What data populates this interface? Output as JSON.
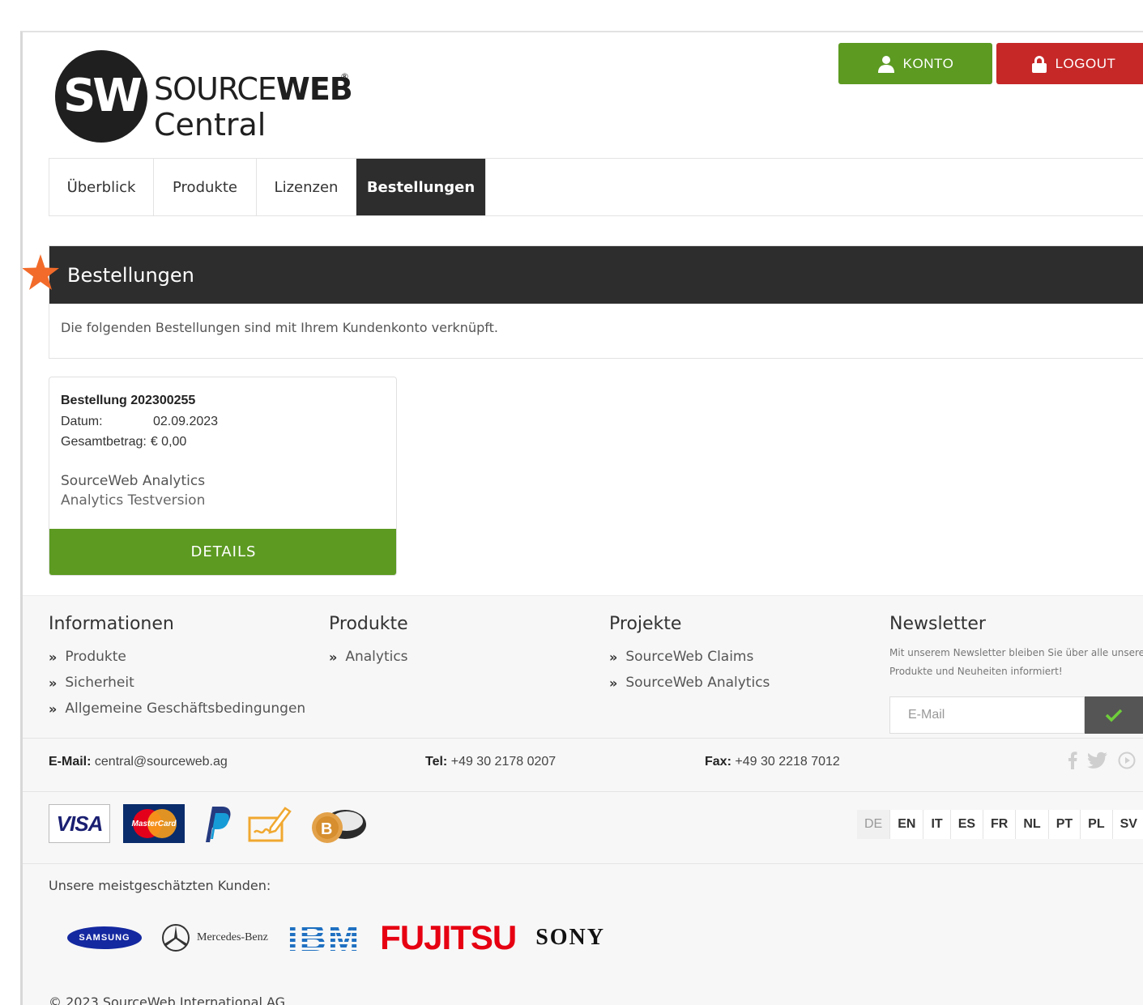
{
  "header": {
    "logo": {
      "initials": "SW",
      "name_light": "SOURCE",
      "name_bold": "WEB",
      "registered": "®",
      "subtitle": "Central"
    },
    "konto_label": "KONTO",
    "logout_label": "LOGOUT"
  },
  "nav": {
    "tabs": [
      {
        "label": "Überblick",
        "active": false
      },
      {
        "label": "Produkte",
        "active": false
      },
      {
        "label": "Lizenzen",
        "active": false
      },
      {
        "label": "Bestellungen",
        "active": true
      }
    ]
  },
  "panel": {
    "title": "Bestellungen",
    "description": "Die folgenden Bestellungen sind mit Ihrem Kundenkonto verknüpft."
  },
  "order": {
    "title": "Bestellung 202300255",
    "date_label": "Datum:",
    "date_value": "02.09.2023",
    "total_label": "Gesamtbetrag:",
    "total_value": "€ 0,00",
    "product": "SourceWeb Analytics",
    "product_variant": "Analytics Testversion",
    "details_label": "DETAILS"
  },
  "footer": {
    "info": {
      "heading": "Informationen",
      "links": [
        "Produkte",
        "Sicherheit",
        "Allgemeine Geschäftsbedingungen"
      ]
    },
    "products": {
      "heading": "Produkte",
      "links": [
        "Analytics"
      ]
    },
    "projects": {
      "heading": "Projekte",
      "links": [
        "SourceWeb Claims",
        "SourceWeb Analytics"
      ]
    },
    "newsletter": {
      "heading": "Newsletter",
      "text": "Mit unserem Newsletter bleiben Sie über alle unsere Produkte und Neuheiten informiert!",
      "placeholder": "E-Mail"
    },
    "contact": {
      "email_label": "E-Mail:",
      "email": "central@sourceweb.ag",
      "tel_label": "Tel:",
      "tel": "+49 30 2178 0207",
      "fax_label": "Fax:",
      "fax": "+49 30 2218 7012"
    },
    "payment": {
      "visa": "VISA",
      "mastercard": "MasterCard"
    },
    "languages": [
      "DE",
      "EN",
      "IT",
      "ES",
      "FR",
      "NL",
      "PT",
      "PL",
      "SV"
    ],
    "customers_label": "Unsere meistgeschätzten Kunden:",
    "customers": [
      "SAMSUNG",
      "Mercedes-Benz",
      "IBM",
      "FUJITSU",
      "SONY"
    ],
    "copyright": "© 2023 SourceWeb International AG"
  },
  "colors": {
    "green": "#5c9a22",
    "red": "#c62828",
    "dark": "#2d2d2d",
    "star": "#f26b2a"
  }
}
